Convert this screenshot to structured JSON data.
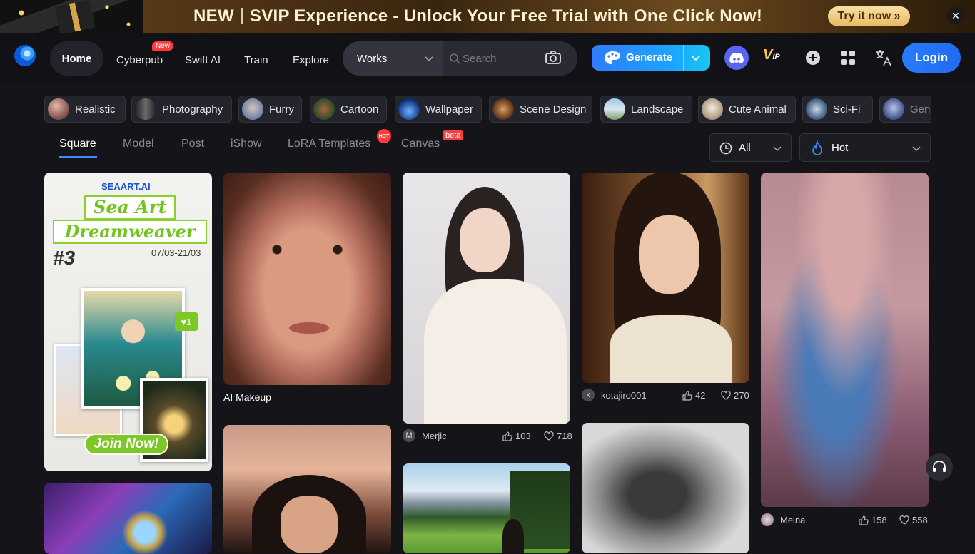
{
  "banner": {
    "new_label": "NEW",
    "headline": "SVIP Experience - Unlock Your Free Trial with One Click Now!",
    "cta": "Try it now »",
    "close": "✕"
  },
  "nav": {
    "home": "Home",
    "cyberpub": "Cyberpub",
    "new_badge": "New",
    "swift_ai": "Swift AI",
    "train": "Train",
    "explore": "Explore",
    "search_scope": "Works",
    "search_placeholder": "Search",
    "generate": "Generate",
    "login": "Login",
    "vip": "V",
    "vip_sub": "IP"
  },
  "categories": [
    "Realistic",
    "Photography",
    "Furry",
    "Cartoon",
    "Wallpaper",
    "Scene Design",
    "Landscape",
    "Cute Animal",
    "Sci-Fi",
    "Gen"
  ],
  "tabs": {
    "square": "Square",
    "model": "Model",
    "post": "Post",
    "ishow": "iShow",
    "lora": "LoRA Templates",
    "hot_badge": "HOT",
    "canvas": "Canvas",
    "beta_badge": "beta"
  },
  "filters": {
    "time": "All",
    "sort": "Hot"
  },
  "poster": {
    "brand": "SEAART.AI",
    "title1": "Sea Art",
    "title2": "Dreamweaver",
    "number": "#3",
    "dates": "07/03-21/03",
    "join": "Join Now!",
    "like_count": "1"
  },
  "gallery": {
    "makeup_caption": "AI Makeup",
    "post1": {
      "avatar": "M",
      "author": "Merjic",
      "likes": "103",
      "hearts": "718"
    },
    "post2": {
      "avatar": "k",
      "author": "kotajiro001",
      "likes": "42",
      "hearts": "270"
    },
    "post3": {
      "avatar": "",
      "author": "Meina",
      "likes": "158",
      "hearts": "558"
    }
  },
  "colors": {
    "accent": "#2a7bff",
    "badge_red": "#ff3b3b",
    "background": "#141419"
  }
}
